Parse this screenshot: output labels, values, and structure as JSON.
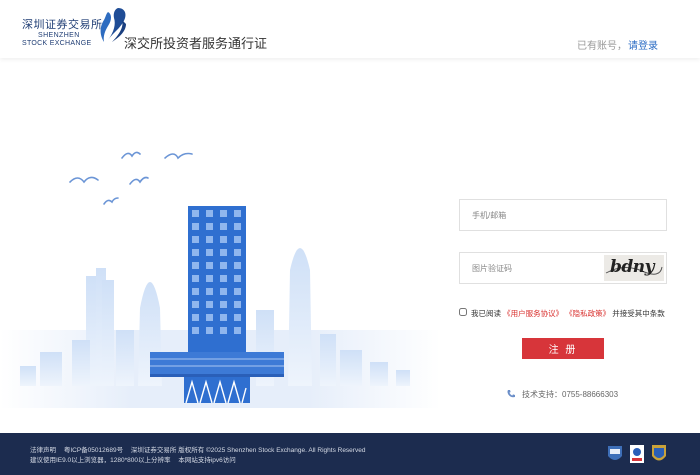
{
  "header": {
    "logo_cn": "深圳证券交易所",
    "logo_en_line1": "SHENZHEN",
    "logo_en_line2": "STOCK EXCHANGE",
    "site_title": "深交所投资者服务通行证",
    "have_account": "已有账号，",
    "login_link": "请登录"
  },
  "form": {
    "phone_placeholder": "手机/邮箱",
    "captcha_placeholder": "图片验证码",
    "captcha_text": "bdny",
    "agree_prefix": "我已阅读",
    "user_agreement": "《用户服务协议》",
    "privacy_policy": "《隐私政策》",
    "agree_suffix": "并接受其中条款",
    "register_button": "注 册"
  },
  "support": {
    "label": "技术支持：",
    "phone": "0755-88666303"
  },
  "footer": {
    "legal": "法律声明",
    "icp": "粤ICP备05012689号",
    "copyright": "深圳证券交易所 版权所有 ©2025 Shenzhen Stock Exchange. All Rights Reserved",
    "browser_tip": "建议使用IE9.0以上浏览器，1280*800以上分辨率",
    "ipv6": "本网站支持ipv6访问"
  },
  "colors": {
    "brand_blue": "#1f3d74",
    "link_blue": "#2b6cc4",
    "register_red": "#d7353a",
    "footer_bg": "#1c2c4f"
  }
}
